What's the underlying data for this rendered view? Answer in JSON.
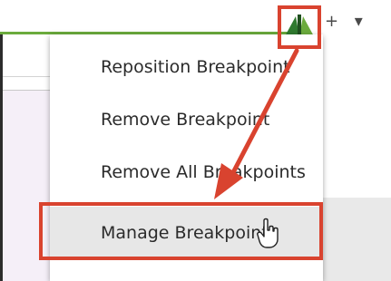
{
  "menu": {
    "items": [
      {
        "label": "Reposition Breakpoint"
      },
      {
        "label": "Remove Breakpoint"
      },
      {
        "label": "Remove All Breakpoints"
      },
      {
        "label": "Manage Breakpoint"
      }
    ],
    "hovered_index": 3
  },
  "toolbar": {
    "glyphs": "+ ▾"
  },
  "icons": {
    "breakpoint_marker": "breakpoint-marker-icon",
    "cursor": "hand-pointer-icon"
  },
  "colors": {
    "annotation": "#d9432f",
    "accent_green": "#6bab3d",
    "menu_hover": "#e7e7e7",
    "panel_lavender": "#f5eff8"
  }
}
